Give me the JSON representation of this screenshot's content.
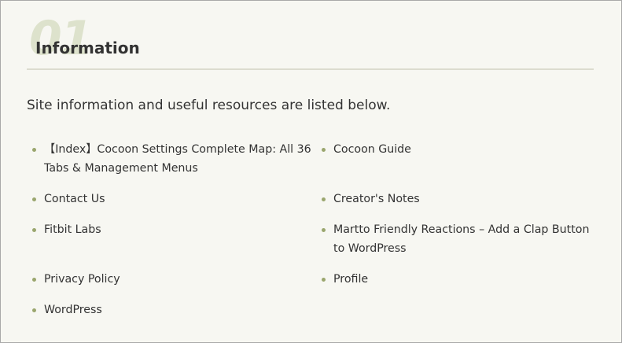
{
  "section": {
    "number": "01",
    "title": "Information",
    "intro": "Site information and useful resources are listed below."
  },
  "links": [
    {
      "label": "【Index】Cocoon Settings Complete Map: All 36 Tabs & Management Menus"
    },
    {
      "label": "Cocoon Guide"
    },
    {
      "label": "Contact Us"
    },
    {
      "label": "Creator's Notes"
    },
    {
      "label": "Fitbit Labs"
    },
    {
      "label": "Martto Friendly Reactions – Add a Clap Button to WordPress"
    },
    {
      "label": "Privacy Policy"
    },
    {
      "label": "Profile"
    },
    {
      "label": "WordPress"
    }
  ],
  "colors": {
    "background": "#f7f7f2",
    "bullet": "#9aa66e",
    "heading_number": "#dde2cc",
    "divider": "#dcdccf",
    "text": "#333333"
  }
}
